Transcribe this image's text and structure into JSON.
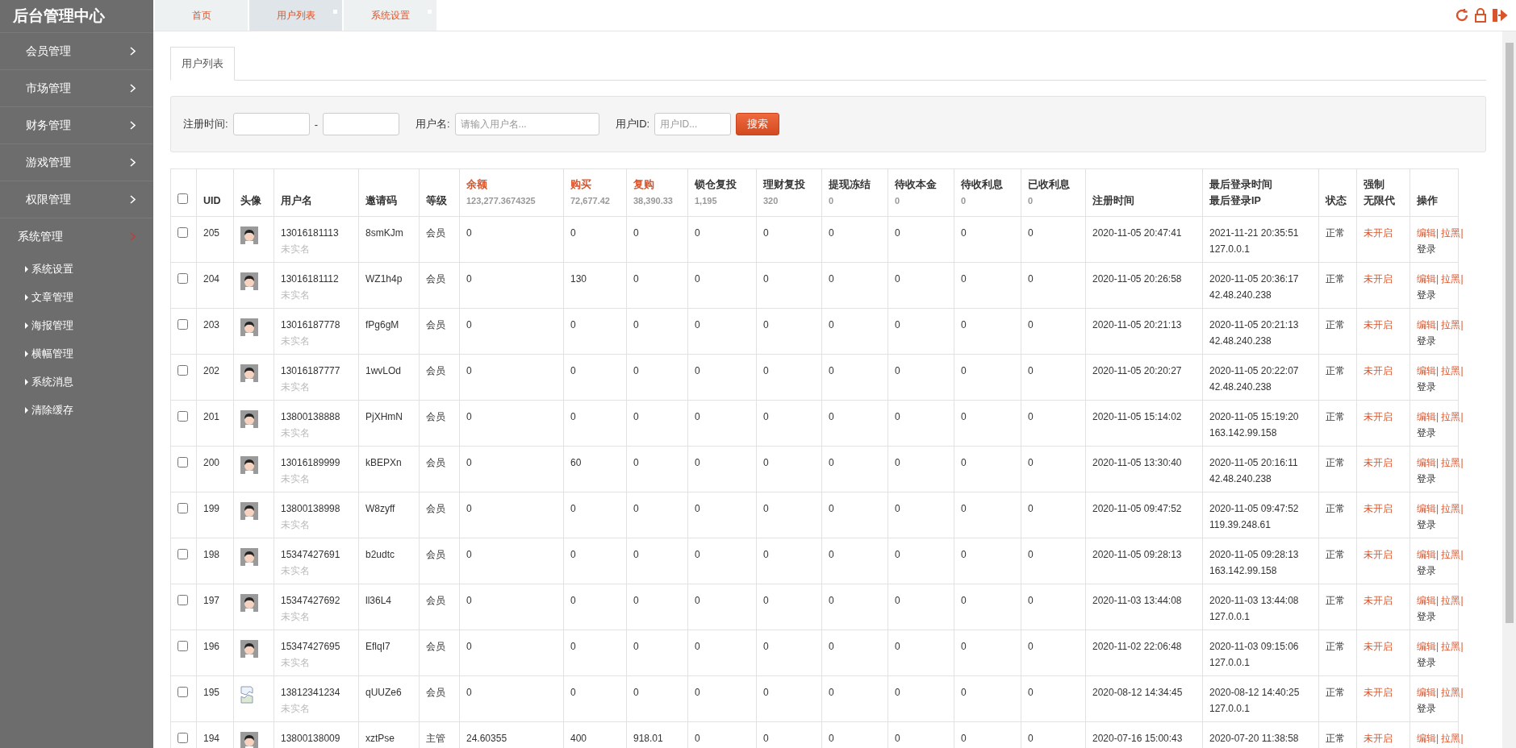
{
  "sidebar": {
    "title": "后台管理中心",
    "items": [
      {
        "label": "会员管理",
        "expanded": false
      },
      {
        "label": "市场管理",
        "expanded": false
      },
      {
        "label": "财务管理",
        "expanded": false
      },
      {
        "label": "游戏管理",
        "expanded": false
      },
      {
        "label": "权限管理",
        "expanded": false
      },
      {
        "label": "系统管理",
        "expanded": true,
        "children": [
          {
            "label": "系统设置"
          },
          {
            "label": "文章管理"
          },
          {
            "label": "海报管理"
          },
          {
            "label": "横幅管理"
          },
          {
            "label": "系统消息"
          },
          {
            "label": "清除缓存"
          }
        ]
      }
    ]
  },
  "tabs": [
    {
      "label": "首页",
      "selected": false,
      "closable": false
    },
    {
      "label": "用户列表",
      "selected": true,
      "closable": true
    },
    {
      "label": "系统设置",
      "selected": false,
      "closable": true
    }
  ],
  "subtabs": [
    {
      "label": "用户列表",
      "selected": true
    }
  ],
  "filters": {
    "reg_time_label": "注册时间:",
    "range_sep": "-",
    "username_label": "用户名:",
    "username_placeholder": "请输入用户名...",
    "uid_label": "用户ID:",
    "uid_placeholder": "用户ID...",
    "search_button": "搜索"
  },
  "table": {
    "select_all_checked": false,
    "columns": [
      {
        "label": "UID",
        "highlight": false
      },
      {
        "label": "头像",
        "highlight": false
      },
      {
        "label": "用户名",
        "highlight": false
      },
      {
        "label": "邀请码",
        "highlight": false
      },
      {
        "label": "等级",
        "highlight": false
      },
      {
        "label": "余额",
        "total": "123,277.3674325",
        "highlight": true
      },
      {
        "label": "购买",
        "total": "72,677.42",
        "highlight": true
      },
      {
        "label": "复购",
        "total": "38,390.33",
        "highlight": true
      },
      {
        "label": "锁仓复投",
        "total": "1,195",
        "highlight": false
      },
      {
        "label": "理财复投",
        "total": "320",
        "highlight": false
      },
      {
        "label": "提现冻结",
        "total": "0",
        "highlight": false
      },
      {
        "label": "待收本金",
        "total": "0",
        "highlight": false
      },
      {
        "label": "待收利息",
        "total": "0",
        "highlight": false
      },
      {
        "label": "已收利息",
        "total": "0",
        "highlight": false
      },
      {
        "label": "注册时间",
        "highlight": false
      },
      {
        "label": "最后登录时间",
        "label_2": "最后登录IP",
        "highlight": false
      },
      {
        "label": "状态",
        "highlight": false
      },
      {
        "label": "强制",
        "label_2": "无限代",
        "highlight": false
      },
      {
        "label": "操作",
        "highlight": false
      }
    ],
    "rows": [
      {
        "checked": false,
        "uid": "205",
        "avatar_broken": false,
        "username": "13016181113",
        "realname": "未实名",
        "invite": "8smKJm",
        "level": "会员",
        "values": [
          "0",
          "0",
          "0",
          "0",
          "0",
          "0",
          "0",
          "0",
          "0"
        ],
        "reg_time": "2020-11-05 20:47:41",
        "last_login": "2021-11-21 20:35:51",
        "last_ip": "127.0.0.1",
        "status": "正常",
        "force": "未开启",
        "actions": [
          {
            "label": "编辑|",
            "kind": "danger"
          },
          {
            "label": "拉黑|",
            "kind": "danger"
          },
          {
            "label": "登录",
            "kind": "plain"
          }
        ]
      },
      {
        "checked": false,
        "uid": "204",
        "avatar_broken": false,
        "username": "13016181112",
        "realname": "未实名",
        "invite": "WZ1h4p",
        "level": "会员",
        "values": [
          "0",
          "130",
          "0",
          "0",
          "0",
          "0",
          "0",
          "0",
          "0"
        ],
        "reg_time": "2020-11-05 20:26:58",
        "last_login": "2020-11-05 20:36:17",
        "last_ip": "42.48.240.238",
        "status": "正常",
        "force": "未开启",
        "actions": [
          {
            "label": "编辑|",
            "kind": "danger"
          },
          {
            "label": "拉黑|",
            "kind": "danger"
          },
          {
            "label": "登录",
            "kind": "plain"
          }
        ]
      },
      {
        "checked": false,
        "uid": "203",
        "avatar_broken": false,
        "username": "13016187778",
        "realname": "未实名",
        "invite": "fPg6gM",
        "level": "会员",
        "values": [
          "0",
          "0",
          "0",
          "0",
          "0",
          "0",
          "0",
          "0",
          "0"
        ],
        "reg_time": "2020-11-05 20:21:13",
        "last_login": "2020-11-05 20:21:13",
        "last_ip": "42.48.240.238",
        "status": "正常",
        "force": "未开启",
        "actions": [
          {
            "label": "编辑|",
            "kind": "danger"
          },
          {
            "label": "拉黑|",
            "kind": "danger"
          },
          {
            "label": "登录",
            "kind": "plain"
          }
        ]
      },
      {
        "checked": false,
        "uid": "202",
        "avatar_broken": false,
        "username": "13016187777",
        "realname": "未实名",
        "invite": "1wvLOd",
        "level": "会员",
        "values": [
          "0",
          "0",
          "0",
          "0",
          "0",
          "0",
          "0",
          "0",
          "0"
        ],
        "reg_time": "2020-11-05 20:20:27",
        "last_login": "2020-11-05 20:22:07",
        "last_ip": "42.48.240.238",
        "status": "正常",
        "force": "未开启",
        "actions": [
          {
            "label": "编辑|",
            "kind": "danger"
          },
          {
            "label": "拉黑|",
            "kind": "danger"
          },
          {
            "label": "登录",
            "kind": "plain"
          }
        ]
      },
      {
        "checked": false,
        "uid": "201",
        "avatar_broken": false,
        "username": "13800138888",
        "realname": "未实名",
        "invite": "PjXHmN",
        "level": "会员",
        "values": [
          "0",
          "0",
          "0",
          "0",
          "0",
          "0",
          "0",
          "0",
          "0"
        ],
        "reg_time": "2020-11-05 15:14:02",
        "last_login": "2020-11-05 15:19:20",
        "last_ip": "163.142.99.158",
        "status": "正常",
        "force": "未开启",
        "actions": [
          {
            "label": "编辑|",
            "kind": "danger"
          },
          {
            "label": "拉黑|",
            "kind": "danger"
          },
          {
            "label": "登录",
            "kind": "plain"
          }
        ]
      },
      {
        "checked": false,
        "uid": "200",
        "avatar_broken": false,
        "username": "13016189999",
        "realname": "未实名",
        "invite": "kBEPXn",
        "level": "会员",
        "values": [
          "0",
          "60",
          "0",
          "0",
          "0",
          "0",
          "0",
          "0",
          "0"
        ],
        "reg_time": "2020-11-05 13:30:40",
        "last_login": "2020-11-05 20:16:11",
        "last_ip": "42.48.240.238",
        "status": "正常",
        "force": "未开启",
        "actions": [
          {
            "label": "编辑|",
            "kind": "danger"
          },
          {
            "label": "拉黑|",
            "kind": "danger"
          },
          {
            "label": "登录",
            "kind": "plain"
          }
        ]
      },
      {
        "checked": false,
        "uid": "199",
        "avatar_broken": false,
        "username": "13800138998",
        "realname": "未实名",
        "invite": "W8zyff",
        "level": "会员",
        "values": [
          "0",
          "0",
          "0",
          "0",
          "0",
          "0",
          "0",
          "0",
          "0"
        ],
        "reg_time": "2020-11-05 09:47:52",
        "last_login": "2020-11-05 09:47:52",
        "last_ip": "119.39.248.61",
        "status": "正常",
        "force": "未开启",
        "actions": [
          {
            "label": "编辑|",
            "kind": "danger"
          },
          {
            "label": "拉黑|",
            "kind": "danger"
          },
          {
            "label": "登录",
            "kind": "plain"
          }
        ]
      },
      {
        "checked": false,
        "uid": "198",
        "avatar_broken": false,
        "username": "15347427691",
        "realname": "未实名",
        "invite": "b2udtc",
        "level": "会员",
        "values": [
          "0",
          "0",
          "0",
          "0",
          "0",
          "0",
          "0",
          "0",
          "0"
        ],
        "reg_time": "2020-11-05 09:28:13",
        "last_login": "2020-11-05 09:28:13",
        "last_ip": "163.142.99.158",
        "status": "正常",
        "force": "未开启",
        "actions": [
          {
            "label": "编辑|",
            "kind": "danger"
          },
          {
            "label": "拉黑|",
            "kind": "danger"
          },
          {
            "label": "登录",
            "kind": "plain"
          }
        ]
      },
      {
        "checked": false,
        "uid": "197",
        "avatar_broken": false,
        "username": "15347427692",
        "realname": "未实名",
        "invite": "ll36L4",
        "level": "会员",
        "values": [
          "0",
          "0",
          "0",
          "0",
          "0",
          "0",
          "0",
          "0",
          "0"
        ],
        "reg_time": "2020-11-03 13:44:08",
        "last_login": "2020-11-03 13:44:08",
        "last_ip": "127.0.0.1",
        "status": "正常",
        "force": "未开启",
        "actions": [
          {
            "label": "编辑|",
            "kind": "danger"
          },
          {
            "label": "拉黑|",
            "kind": "danger"
          },
          {
            "label": "登录",
            "kind": "plain"
          }
        ]
      },
      {
        "checked": false,
        "uid": "196",
        "avatar_broken": false,
        "username": "15347427695",
        "realname": "未实名",
        "invite": "EflqI7",
        "level": "会员",
        "values": [
          "0",
          "0",
          "0",
          "0",
          "0",
          "0",
          "0",
          "0",
          "0"
        ],
        "reg_time": "2020-11-02 22:06:48",
        "last_login": "2020-11-03 09:15:06",
        "last_ip": "127.0.0.1",
        "status": "正常",
        "force": "未开启",
        "actions": [
          {
            "label": "编辑|",
            "kind": "danger"
          },
          {
            "label": "拉黑|",
            "kind": "danger"
          },
          {
            "label": "登录",
            "kind": "plain"
          }
        ]
      },
      {
        "checked": false,
        "uid": "195",
        "avatar_broken": true,
        "username": "13812341234",
        "realname": "未实名",
        "invite": "qUUZe6",
        "level": "会员",
        "values": [
          "0",
          "0",
          "0",
          "0",
          "0",
          "0",
          "0",
          "0",
          "0"
        ],
        "reg_time": "2020-08-12 14:34:45",
        "last_login": "2020-08-12 14:40:25",
        "last_ip": "127.0.0.1",
        "status": "正常",
        "force": "未开启",
        "actions": [
          {
            "label": "编辑|",
            "kind": "danger"
          },
          {
            "label": "拉黑|",
            "kind": "danger"
          },
          {
            "label": "登录",
            "kind": "plain"
          }
        ]
      },
      {
        "checked": false,
        "uid": "194",
        "avatar_broken": false,
        "username": "13800138009",
        "invite": "xztPse",
        "level": "主管",
        "values": [
          "24.60355",
          "400",
          "918.01",
          "0",
          "0",
          "0",
          "0",
          "0",
          "0"
        ],
        "reg_time": "2020-07-16 15:00:43",
        "last_login": "2020-07-20 11:38:58",
        "status": "正常",
        "force": "未开启",
        "actions": [
          {
            "label": "编辑|",
            "kind": "danger"
          },
          {
            "label": "拉黑|",
            "kind": "danger"
          }
        ]
      }
    ]
  }
}
